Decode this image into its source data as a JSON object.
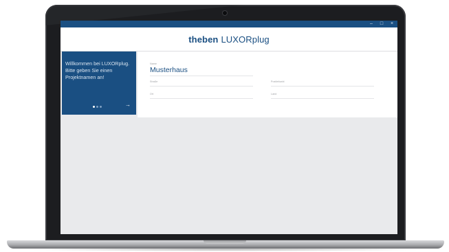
{
  "window": {
    "controls": [
      "–",
      "□",
      "×"
    ]
  },
  "header": {
    "brand": "theben",
    "product": "LUXORplug"
  },
  "welcome": {
    "text": "Willkommen bei LUXORplug. Bitte geben Sie einen Projektnamen an!",
    "next_icon": "arrow-right-icon"
  },
  "project": {
    "name_caption": "Name",
    "name_value": "Musterhaus",
    "field_captions": [
      "Straße",
      "Postleitzahl",
      "Ort",
      "Land"
    ]
  },
  "colors": {
    "accent": "#1a4f82",
    "background": "#e9eaec"
  }
}
